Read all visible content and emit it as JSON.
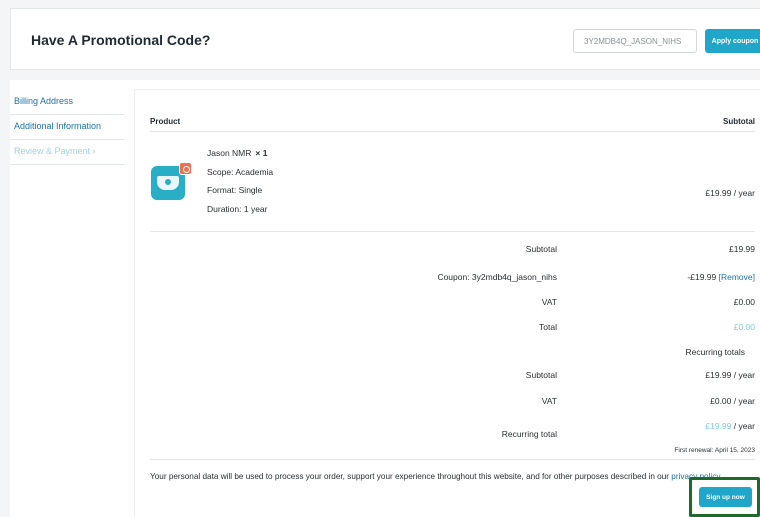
{
  "promo": {
    "title": "Have A Promotional Code?",
    "coupon_value": "3Y2MDB4Q_JASON_NIHS",
    "apply_label": "Apply coupon"
  },
  "sidebar": {
    "items": [
      {
        "label": "Billing Address"
      },
      {
        "label": "Additional Information"
      },
      {
        "label": "Review & Payment ›"
      }
    ]
  },
  "order": {
    "header_product": "Product",
    "header_subtotal": "Subtotal",
    "product": {
      "name": "Jason NMR",
      "qty": "× 1",
      "scope": "Scope: Academia",
      "format": "Format: Single",
      "duration": "Duration: 1 year",
      "price": "£19.99 / year"
    },
    "subtotal_label": "Subtotal",
    "subtotal_value": "£19.99",
    "coupon_label": "Coupon: 3y2mdb4q_jason_nihs",
    "coupon_value": "-£19.99",
    "remove_label": "[Remove]",
    "vat_label": "VAT",
    "vat_value": "£0.00",
    "total_label": "Total",
    "total_value": "£0.00",
    "recurring_heading": "Recurring totals",
    "rec_subtotal_label": "Subtotal",
    "rec_subtotal_value": "£19.99 / year",
    "rec_vat_label": "VAT",
    "rec_vat_value": "£0.00 / year",
    "rec_total_label": "Recurring total",
    "rec_total_amount": "£19.99",
    "rec_total_suffix": " / year",
    "first_renewal": "First renewal: April 15, 2023"
  },
  "privacy": {
    "text": "Your personal data will be used to process your order, support your experience throughout this website, and for other purposes described in our ",
    "link": "privacy policy",
    "end": "."
  },
  "signup_label": "Sign up now"
}
